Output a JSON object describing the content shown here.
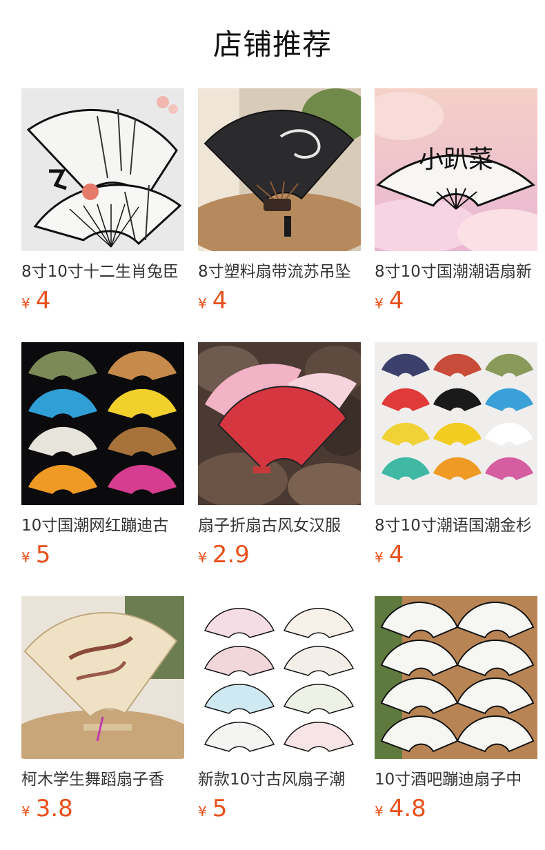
{
  "header": {
    "title": "店铺推荐"
  },
  "colors": {
    "price": "#e8501a",
    "title": "#111111",
    "name": "#333333"
  },
  "products": [
    {
      "name": "8寸10寸十二生肖兔臣",
      "currency": "¥",
      "price": "4",
      "image_icon": "bamboo-ink-fan-icon"
    },
    {
      "name": "8寸塑料扇带流苏吊坠",
      "currency": "¥",
      "price": "4",
      "image_icon": "dragon-black-fan-icon"
    },
    {
      "name": "8寸10寸国潮潮语扇新",
      "currency": "¥",
      "price": "4",
      "image_icon": "calligraphy-fan-cloud-icon"
    },
    {
      "name": "10寸国潮网红蹦迪古",
      "currency": "¥",
      "price": "5",
      "image_icon": "colorful-fans-set-icon"
    },
    {
      "name": "扇子折扇古风女汉服",
      "currency": "¥",
      "price": "2.9",
      "image_icon": "red-pink-fans-stones-icon"
    },
    {
      "name": "8寸10寸潮语国潮金杉",
      "currency": "¥",
      "price": "4",
      "image_icon": "wall-fans-grid-icon"
    },
    {
      "name": "柯木学生舞蹈扇子香",
      "currency": "¥",
      "price": "3.8",
      "image_icon": "sandalwood-fan-icon"
    },
    {
      "name": "新款10寸古风扇子潮",
      "currency": "¥",
      "price": "5",
      "image_icon": "painted-fans-set-icon"
    },
    {
      "name": "10寸酒吧蹦迪扇子中",
      "currency": "¥",
      "price": "4.8",
      "image_icon": "white-calligraphy-fans-icon"
    }
  ]
}
